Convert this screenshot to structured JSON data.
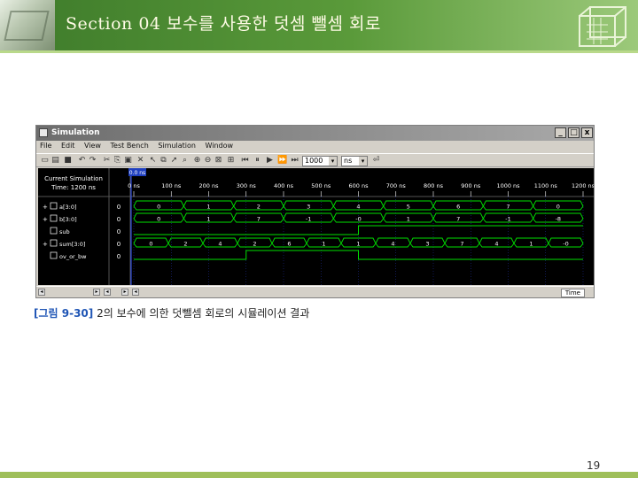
{
  "slide": {
    "title": "Section 04 보수를 사용한 덧셈 뺄셈 회로",
    "caption_fig": "[그림 9-30]",
    "caption_text": "2의 보수에 의한 덧뺄셈 회로의 시뮬레이션 결과",
    "page_number": "19"
  },
  "colors": {
    "header_green": "#4e8d33",
    "caption_blue": "#1f55b5",
    "wave_green": "#00e000",
    "wave_bg": "#000000",
    "grid_blue": "#2233aa"
  },
  "window": {
    "title": "Simulation",
    "min_label": "_",
    "max_label": "□",
    "close_label": "x",
    "menu": [
      "File",
      "Edit",
      "View",
      "Test Bench",
      "Simulation",
      "Window"
    ],
    "step_value": "1000",
    "unit_value": "ns",
    "tab_label": "Time"
  },
  "sim": {
    "header_line1": "Current Simulation",
    "header_line2": "Time: 1200 ns",
    "cursor_label": "0.0 ns",
    "ruler": [
      "0 ns",
      "100 ns",
      "200 ns",
      "300 ns",
      "400 ns",
      "500 ns",
      "600 ns",
      "700 ns",
      "800 ns",
      "900 ns",
      "1000 ns",
      "1100 ns",
      "1200 ns"
    ],
    "signals": [
      {
        "name": "a[3:0]",
        "value": "0",
        "kind": "bus",
        "expand": "+",
        "segments": [
          "0",
          "1",
          "2",
          "3",
          "4",
          "5",
          "6",
          "7",
          "0"
        ]
      },
      {
        "name": "b[3:0]",
        "value": "0",
        "kind": "bus",
        "expand": "+",
        "segments": [
          "0",
          "1",
          "7",
          "-1",
          "-0",
          "1",
          "7",
          "-1",
          "-8"
        ]
      },
      {
        "name": "sub",
        "value": "0",
        "kind": "bit",
        "expand": "",
        "levels": [
          0,
          0,
          0,
          0,
          1,
          1,
          1,
          1
        ]
      },
      {
        "name": "sum[3:0]",
        "value": "0",
        "kind": "bus",
        "expand": "+",
        "segments": [
          "0",
          "2",
          "4",
          "2",
          "6",
          "1",
          "1",
          "4",
          "3",
          "7",
          "4",
          "1",
          "-0"
        ]
      },
      {
        "name": "ov_or_bw",
        "value": "0",
        "kind": "bit",
        "expand": "",
        "levels": [
          0,
          0,
          1,
          1,
          0,
          0,
          0,
          0
        ]
      }
    ]
  }
}
